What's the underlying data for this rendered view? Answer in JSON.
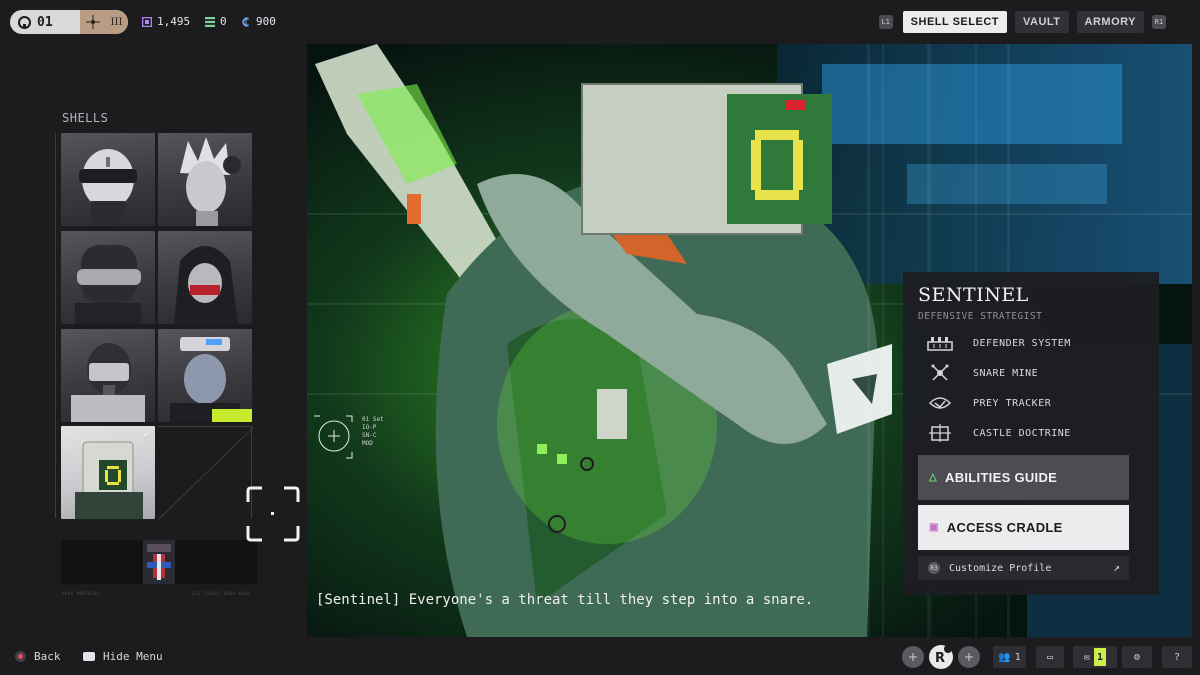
{
  "topbar": {
    "player_id": "01",
    "rank": "III",
    "currencies": [
      {
        "icon": "cube-currency-icon",
        "value": "1,495",
        "color": "#b084f5"
      },
      {
        "icon": "ledger-currency-icon",
        "value": "0",
        "color": "#7ed39a"
      },
      {
        "icon": "credits-currency-icon",
        "value": "900",
        "color": "#6fa8f2"
      }
    ],
    "left_hint": "L1",
    "right_hint": "R1",
    "tabs": [
      "SHELL SELECT",
      "VAULT",
      "ARMORY"
    ],
    "active_tab": "SHELL SELECT"
  },
  "shells": {
    "label": "SHELLS",
    "items": [
      {
        "name": "shell-portrait-visor"
      },
      {
        "name": "shell-portrait-spiky-hair"
      },
      {
        "name": "shell-portrait-heavy-helm"
      },
      {
        "name": "shell-portrait-hooded"
      },
      {
        "name": "shell-portrait-masked"
      },
      {
        "name": "shell-portrait-headset"
      },
      {
        "name": "shell-portrait-sentinel",
        "selected": true
      }
    ],
    "banner_left": "ROOK PROTOCOL",
    "banner_right": "SIG TALENT 0000-0000"
  },
  "hero": {
    "hud_lines": [
      "01 Set",
      "IO-P",
      "SN-C",
      "MOD"
    ],
    "subtitle": "[Sentinel] Everyone's a threat till they step into a snare.",
    "accent_color": "#7cf53a"
  },
  "card": {
    "name": "SENTINEL",
    "role": "DEFENSIVE STRATEGIST",
    "abilities": [
      {
        "label": "DEFENDER SYSTEM",
        "icon": "defender-system-icon"
      },
      {
        "label": "SNARE MINE",
        "icon": "snare-mine-icon"
      },
      {
        "label": "PREY TRACKER",
        "icon": "prey-tracker-icon"
      },
      {
        "label": "CASTLE DOCTRINE",
        "icon": "castle-doctrine-icon"
      }
    ],
    "abilities_guide": "ABILITIES GUIDE",
    "access_cradle": "ACCESS CRADLE",
    "customize_hint": "R3",
    "customize": "Customize Profile"
  },
  "bottombar": {
    "back": "Back",
    "hide_menu": "Hide Menu",
    "party_count": "1",
    "mail_count": "1"
  }
}
